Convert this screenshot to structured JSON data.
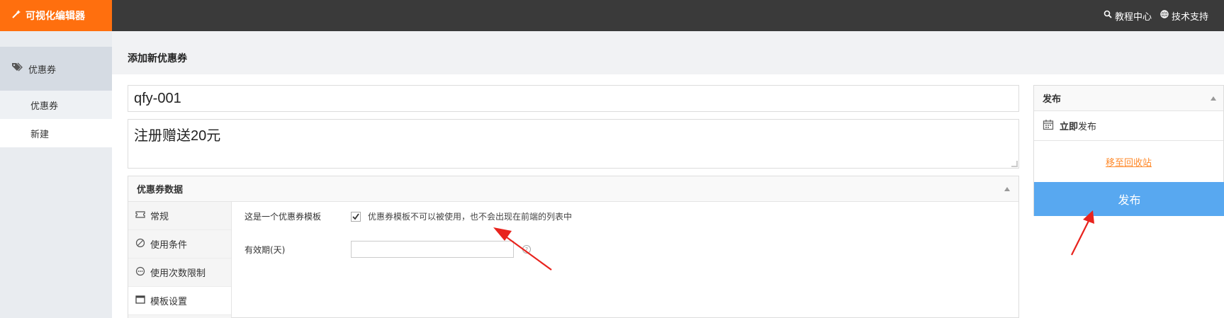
{
  "topbar": {
    "brand": "可视化编辑器",
    "links": [
      {
        "icon": "search-icon",
        "label": "教程中心"
      },
      {
        "icon": "globe-icon",
        "label": "技术支持"
      }
    ]
  },
  "sidebar": {
    "section": "优惠券",
    "items": [
      {
        "label": "优惠券"
      },
      {
        "label": "新建"
      }
    ]
  },
  "page": {
    "title": "添加新优惠券",
    "coupon_code": "qfy-001",
    "description": "注册赠送20元"
  },
  "coupon_data": {
    "heading": "优惠券数据",
    "tabs": [
      {
        "label": "常规",
        "icon": "ticket-icon"
      },
      {
        "label": "使用条件",
        "icon": "block-icon"
      },
      {
        "label": "使用次数限制",
        "icon": "dots-circle-icon"
      },
      {
        "label": "模板设置",
        "icon": "window-icon"
      }
    ],
    "template_label": "这是一个优惠券模板",
    "template_checked": true,
    "template_hint": "优惠券模板不可以被使用，也不会出现在前端的列表中",
    "validity_label": "有效期(天)",
    "validity_value": ""
  },
  "publish": {
    "heading": "发布",
    "schedule_bold": "立即",
    "schedule_rest": "发布",
    "trash_link": "移至回收站",
    "button": "发布"
  },
  "colors": {
    "brand": "#ff6f0e",
    "topbar": "#3a3a3a",
    "publish_button": "#58a8f0",
    "annotation_arrow": "#e8231d"
  }
}
